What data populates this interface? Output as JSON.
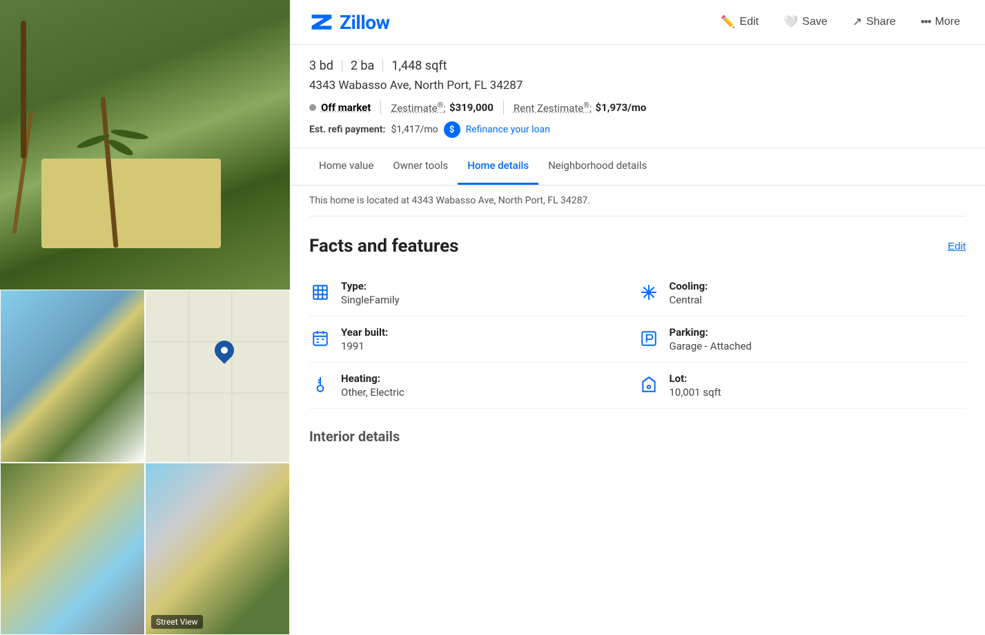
{
  "header": {
    "logo_text": "Zillow",
    "edit_label": "Edit",
    "save_label": "Save",
    "share_label": "Share",
    "more_label": "More"
  },
  "property": {
    "beds": "3 bd",
    "baths": "2 ba",
    "sqft": "1,448 sqft",
    "address": "4343 Wabasso Ave, North Port, FL 34287",
    "status": "Off market",
    "zestimate_label": "Zestimate",
    "zestimate_reg": "®",
    "zestimate_value": "$319,000",
    "rent_zestimate_label": "Rent Zestimate",
    "rent_zestimate_reg": "®",
    "rent_zestimate_value": "$1,973/mo",
    "refi_label": "Est. refi payment:",
    "refi_value": "$1,417/mo",
    "refi_link": "Refinance your loan"
  },
  "tabs": [
    {
      "id": "home-value",
      "label": "Home value"
    },
    {
      "id": "owner-tools",
      "label": "Owner tools"
    },
    {
      "id": "home-details",
      "label": "Home details",
      "active": true
    },
    {
      "id": "neighborhood-details",
      "label": "Neighborhood details"
    }
  ],
  "partial_text": "This home is located at 4343 Wabasso Ave, North Port, FL 34287.",
  "facts": {
    "section_title": "Facts and features",
    "edit_label": "Edit",
    "items_left": [
      {
        "id": "type",
        "icon": "building",
        "label": "Type:",
        "value": "SingleFamily"
      },
      {
        "id": "year-built",
        "icon": "calendar",
        "label": "Year built:",
        "value": "1991"
      },
      {
        "id": "heating",
        "icon": "thermometer",
        "label": "Heating:",
        "value": "Other, Electric"
      }
    ],
    "items_right": [
      {
        "id": "cooling",
        "icon": "snowflake",
        "label": "Cooling:",
        "value": "Central"
      },
      {
        "id": "parking",
        "icon": "parking",
        "label": "Parking:",
        "value": "Garage - Attached"
      },
      {
        "id": "lot",
        "icon": "lot",
        "label": "Lot:",
        "value": "10,001 sqft"
      }
    ]
  },
  "interior": {
    "title": "Interior details"
  },
  "street_view_label": "Street View"
}
